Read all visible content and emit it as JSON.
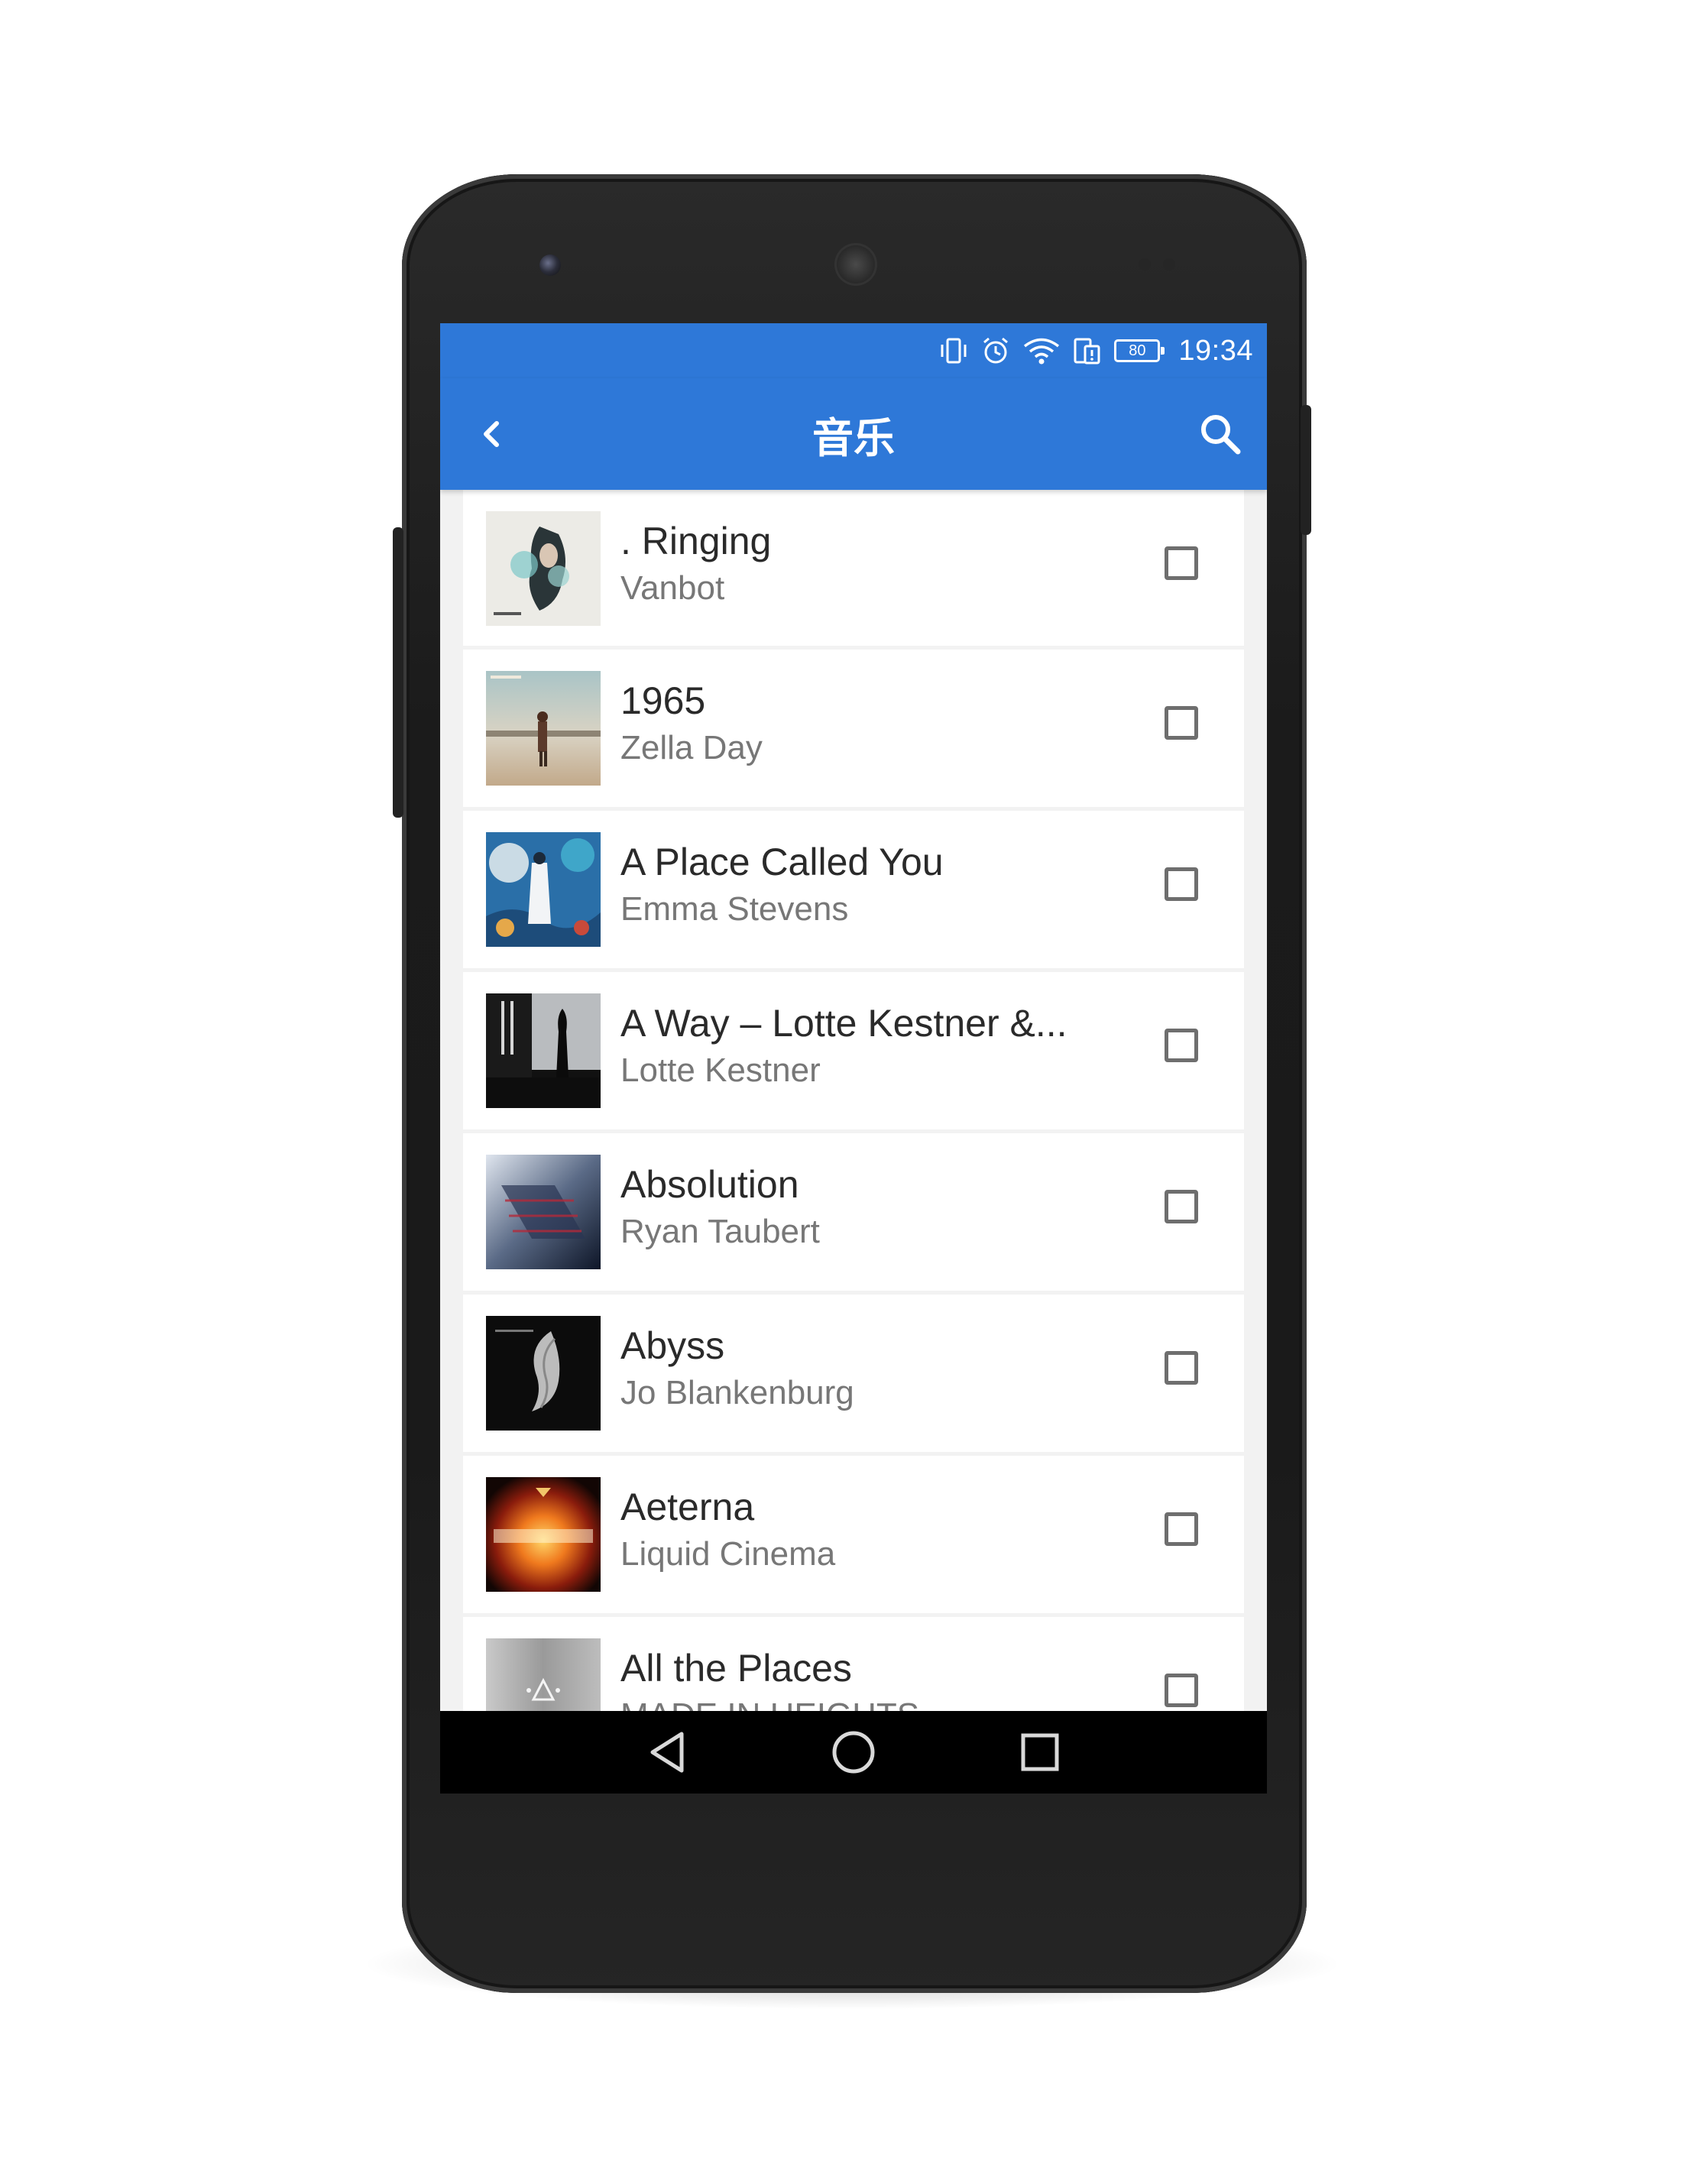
{
  "status_bar": {
    "battery_level": "80",
    "time": "19:34",
    "icons": [
      "vibrate-icon",
      "alarm-icon",
      "wifi-icon",
      "sim-icon",
      "battery-icon"
    ]
  },
  "app_bar": {
    "title": "音乐",
    "back_icon": "chevron-left-icon",
    "search_icon": "search-icon"
  },
  "tracks": [
    {
      "title": ". Ringing",
      "artist": "Vanbot",
      "selected": false
    },
    {
      "title": "1965",
      "artist": "Zella Day",
      "selected": false
    },
    {
      "title": "A Place Called You",
      "artist": "Emma Stevens",
      "selected": false
    },
    {
      "title": "A Way – Lotte Kestner &...",
      "artist": "Lotte Kestner",
      "selected": false
    },
    {
      "title": "Absolution",
      "artist": "Ryan Taubert",
      "selected": false
    },
    {
      "title": "Abyss",
      "artist": "Jo Blankenburg",
      "selected": false
    },
    {
      "title": "Aeterna",
      "artist": "Liquid Cinema",
      "selected": false
    },
    {
      "title": "All the Places",
      "artist": "MADE IN HEIGHTS",
      "selected": false
    }
  ],
  "nav_bar": {
    "icons": [
      "back-triangle-icon",
      "home-circle-icon",
      "recents-square-icon"
    ]
  },
  "colors": {
    "accent": "#2e78d8",
    "list_background": "#f2f2f2",
    "title_text": "#2a2a2a",
    "subtitle_text": "#777777"
  }
}
